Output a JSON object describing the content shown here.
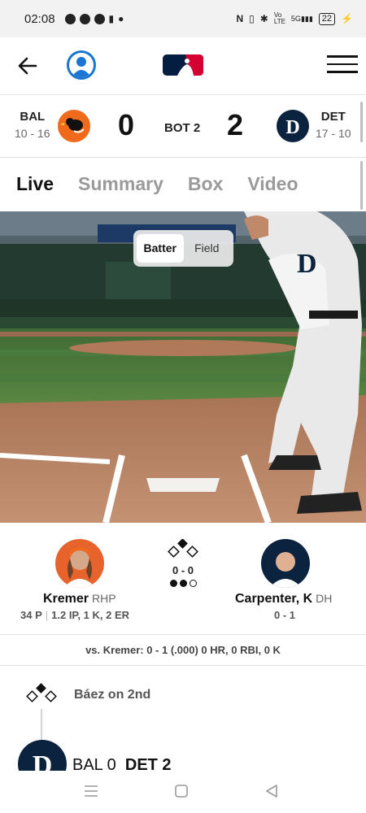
{
  "status_bar": {
    "time": "02:08",
    "battery": "22",
    "network": "5G"
  },
  "score_bar": {
    "away": {
      "abbr": "BAL",
      "record": "10 - 16",
      "score": "0"
    },
    "home": {
      "abbr": "DET",
      "record": "17 - 10",
      "score": "2"
    },
    "inning": "BOT 2"
  },
  "tabs": [
    {
      "label": "Live",
      "active": true
    },
    {
      "label": "Summary",
      "active": false
    },
    {
      "label": "Box",
      "active": false
    },
    {
      "label": "Video",
      "active": false
    }
  ],
  "view_toggle": {
    "options": [
      "Batter",
      "Field"
    ],
    "selected": "Batter"
  },
  "matchup": {
    "pitcher": {
      "name": "Kremer",
      "position": "RHP",
      "pitches": "34 P",
      "line": "1.2 IP, 1 K, 2 ER"
    },
    "batter": {
      "name": "Carpenter, K",
      "position": "DH",
      "line": "0 - 1"
    },
    "count": "0 - 0",
    "outs": 2
  },
  "vs_line": "vs. Kremer: 0 - 1 (.000) 0 HR, 0 RBI, 0 K",
  "feed": {
    "event": "Báez on 2nd",
    "score_away": "BAL 0",
    "score_home": "DET 2"
  },
  "colors": {
    "orioles": "#f06a1b",
    "tigers": "#0c2340",
    "accent": "#1976d2",
    "mlb_red": "#d50032",
    "mlb_blue": "#041e42"
  }
}
